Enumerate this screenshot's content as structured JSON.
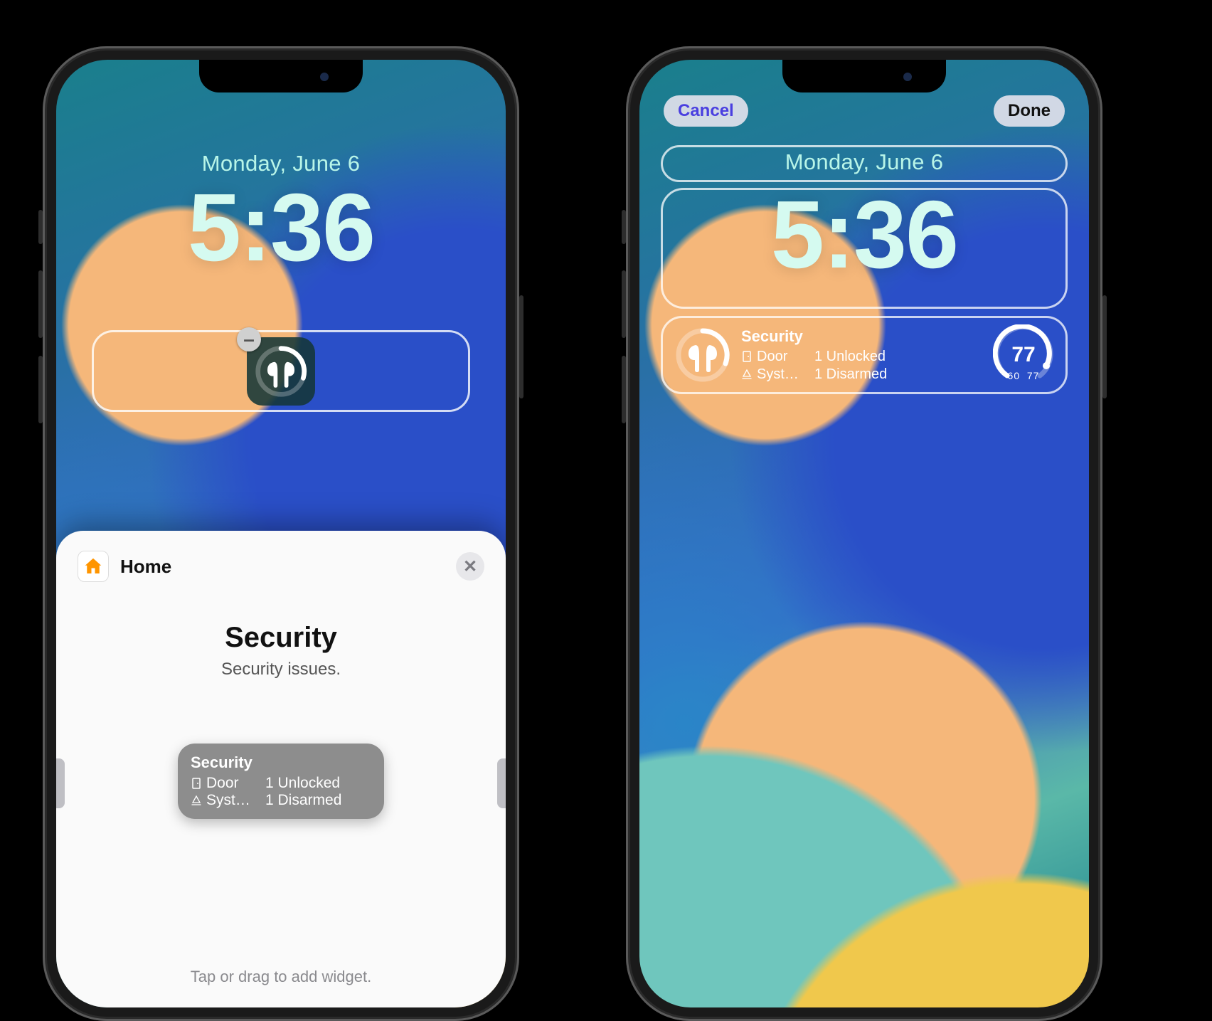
{
  "date": "Monday, June 6",
  "time": "5:36",
  "left": {
    "remove_glyph": "–",
    "sheet": {
      "app_name": "Home",
      "title": "Security",
      "subtitle": "Security issues.",
      "hint": "Tap or drag to add widget.",
      "preview": {
        "title": "Security",
        "rows": [
          {
            "icon": "door",
            "label": "Door",
            "value": "1 Unlocked"
          },
          {
            "icon": "alarm",
            "label": "Syst…",
            "value": "1 Disarmed"
          }
        ]
      }
    }
  },
  "right": {
    "cancel": "Cancel",
    "done": "Done",
    "security": {
      "title": "Security",
      "rows": [
        {
          "icon": "door",
          "label": "Door",
          "value": "1 Unlocked"
        },
        {
          "icon": "alarm",
          "label": "Syst…",
          "value": "1 Disarmed"
        }
      ]
    },
    "gauge": {
      "big": "77",
      "low": "60",
      "high": "77"
    }
  }
}
